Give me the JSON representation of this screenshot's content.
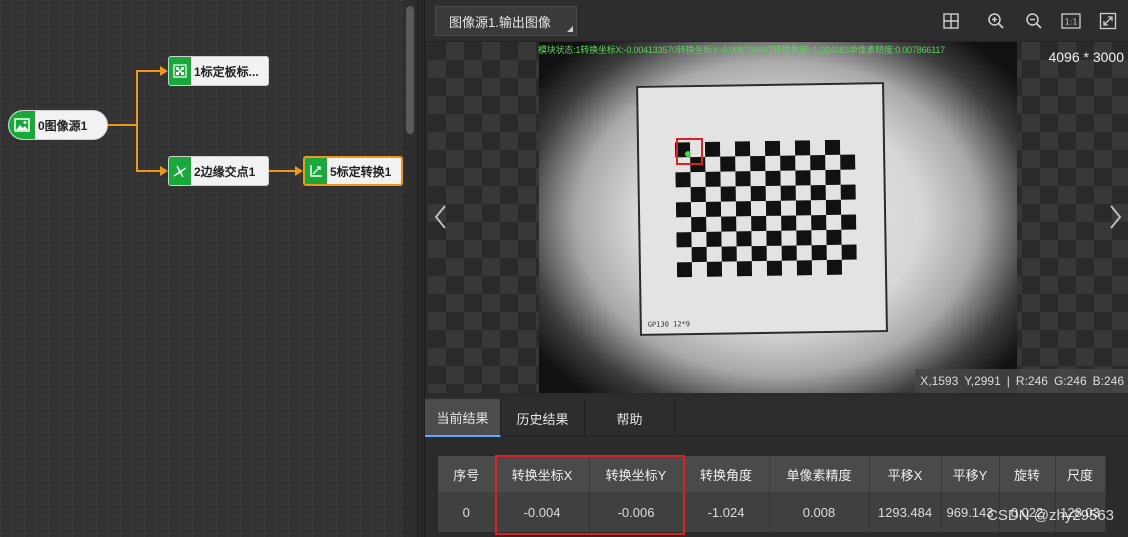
{
  "flow": {
    "nodes": [
      {
        "label": "0图像源1",
        "icon": "image-icon"
      },
      {
        "label": "1标定板标...",
        "icon": "calib-board-icon"
      },
      {
        "label": "2边缘交点1",
        "icon": "edge-intersection-icon"
      },
      {
        "label": "5标定转换1",
        "icon": "calib-transform-icon",
        "selected": true
      }
    ],
    "wire_color": "#f0961a",
    "node_icon_color": "#19a93b"
  },
  "viewer": {
    "source_tab": "图像源1.输出图像",
    "toolbar_icons": [
      "grid-icon",
      "zoom-in-icon",
      "zoom-out-icon",
      "actual-size-icon",
      "fit-screen-icon"
    ],
    "status_overlay": "模块状态:1转换坐标X:-0.004133570转换坐标Y:-0.005799447转换角度:-1.024083单像素精度:0.007866117",
    "resolution": "4096 * 3000",
    "board_text": "GP130 12*9",
    "pixel_info": {
      "x": "X,1593",
      "y": "Y,2991",
      "sep": "|",
      "r": "R:246",
      "g": "G:246",
      "b": "B:246"
    },
    "accent": "#e02020"
  },
  "results": {
    "tabs": [
      {
        "label": "当前结果",
        "active": true
      },
      {
        "label": "历史结果",
        "active": false
      },
      {
        "label": "帮助",
        "active": false
      }
    ],
    "columns": [
      "序号",
      "转换坐标X",
      "转换坐标Y",
      "转换角度",
      "单像素精度",
      "平移X",
      "平移Y",
      "旋转",
      "尺度"
    ],
    "rows": [
      [
        "0",
        "-0.004",
        "-0.006",
        "-1.024",
        "0.008",
        "1293.484",
        "969.143",
        "0.022",
        "128.03"
      ]
    ]
  },
  "watermark": "CSDN @zhy29563"
}
